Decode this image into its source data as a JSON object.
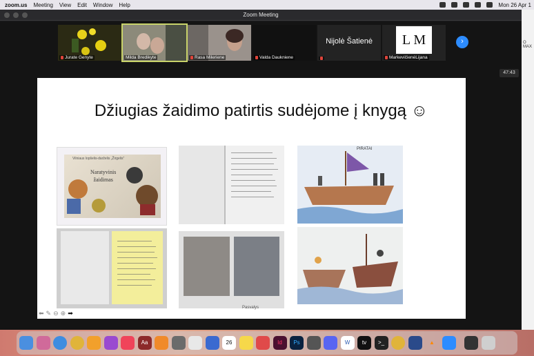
{
  "menubar": {
    "app": "zoom.us",
    "items": [
      "Meeting",
      "View",
      "Edit",
      "Window",
      "Help"
    ],
    "datetime": "Mon 26 Apr 1"
  },
  "window": {
    "title": "Zoom Meeting"
  },
  "participants": [
    {
      "name": "Jurate Genyte"
    },
    {
      "name": "Milda Bredikyte"
    },
    {
      "name": "Rasa Mileriene"
    },
    {
      "name": "Valda Daukniene"
    },
    {
      "name": "",
      "display": "Nijolė Šatienė"
    },
    {
      "name": "MarkevičienėLijana",
      "display": "L M"
    }
  ],
  "timer": "47:43",
  "right_panel_text": "O MAX",
  "slide": {
    "title": "Džiugias žaidimo patirtis sudėjome į knygą ☺",
    "book_cover_small": "Vilniaus lopšelis-darželis „Žirgelis\"",
    "book_cover_title": "Naratyvinis\nžaidimas",
    "photo_caption": "Pasvalys",
    "drawing_text": "PIRATAI"
  },
  "colors": {
    "zoom_blue": "#2d8cff",
    "highlight": "#c9d46a"
  }
}
